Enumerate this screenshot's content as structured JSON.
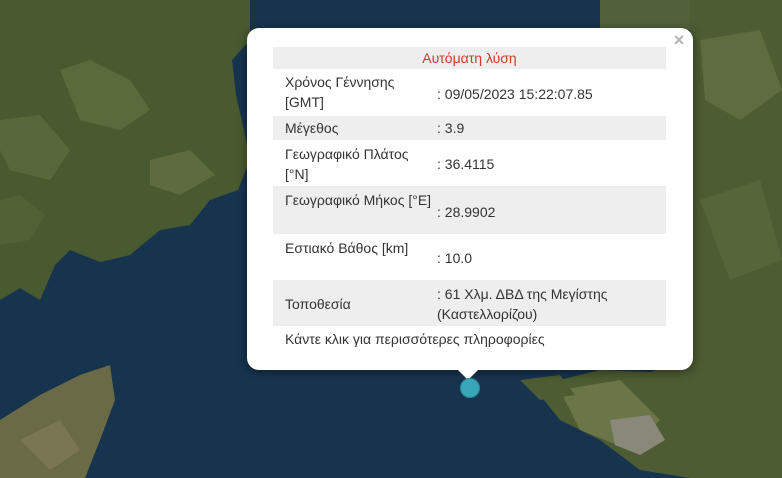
{
  "popup": {
    "title": "Αυτόματη λύση",
    "close_label": "×",
    "rows": [
      {
        "label": "Χρόνος Γέννησης [GMT]",
        "value": ": 09/05/2023 15:22:07.85"
      },
      {
        "label": "Μέγεθος",
        "value": ": 3.9"
      },
      {
        "label": "Γεωγραφικό Πλάτος [°N]",
        "value": ": 36.4115"
      },
      {
        "label": "Γεωγραφικό Μήκος [°E]",
        "value": ": 28.9902"
      },
      {
        "label": "Εστιακό Βάθος [km]",
        "value": ": 10.0"
      },
      {
        "label": "Τοποθεσία",
        "value": ": 61 Χλμ. ΔΒΔ της Μεγίστης (Καστελλορίζου)"
      }
    ],
    "more_link": "Κάντε κλικ για περισσότερες πληροφορίες"
  },
  "colors": {
    "sea": "#16324f",
    "land": "#4b5a32",
    "title_text": "#d9342b",
    "marker": "#3aa4b8"
  }
}
